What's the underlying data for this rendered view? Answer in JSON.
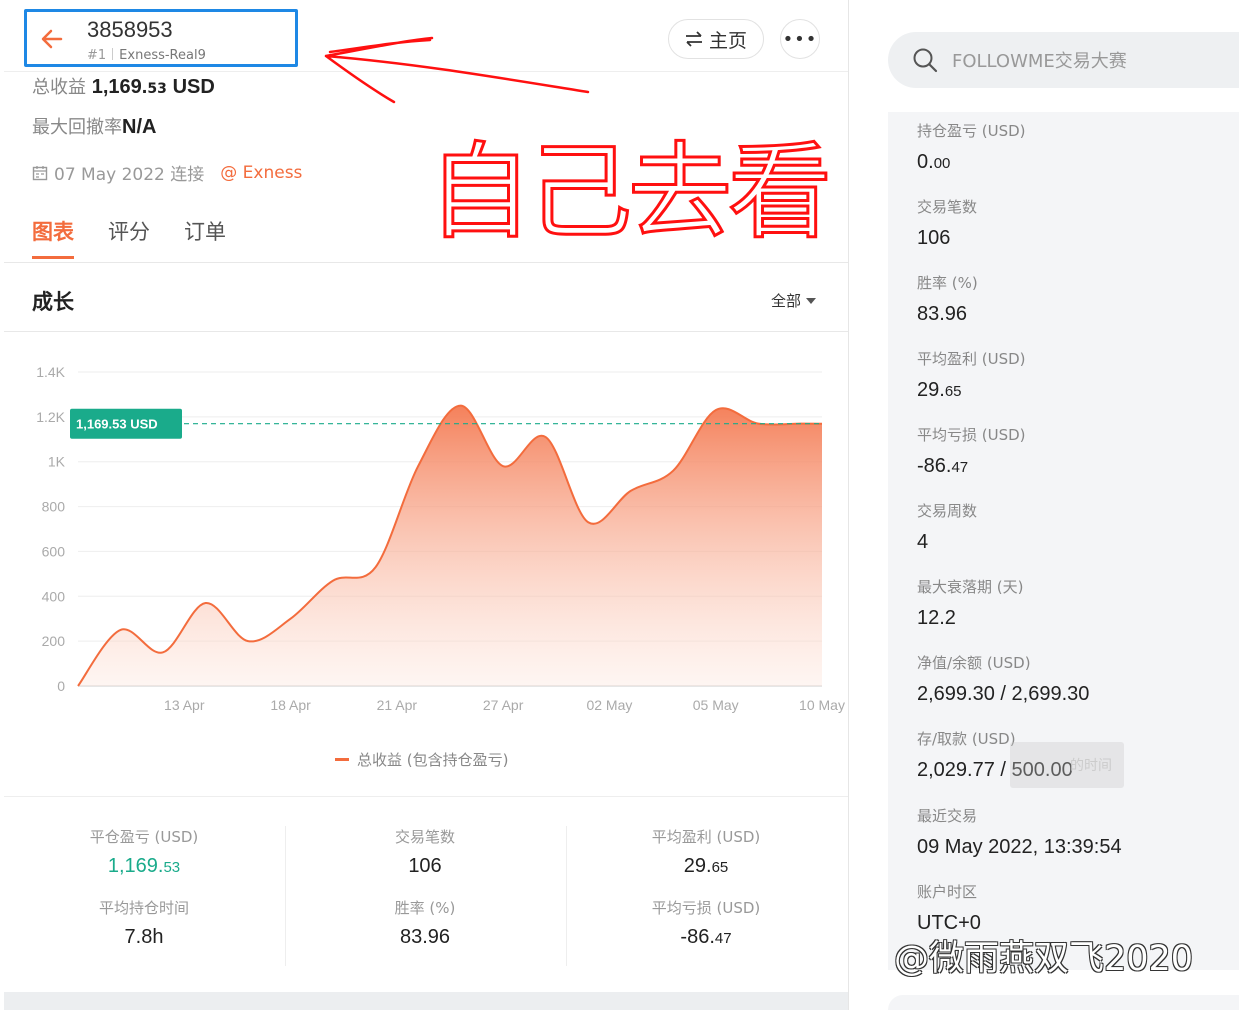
{
  "header": {
    "account_id": "3858953",
    "rank": "#1",
    "server": "Exness-Real9",
    "home_label": "主页",
    "more_label": "•••"
  },
  "summary": {
    "total_profit_label": "总收益",
    "total_profit_value": "1,169.",
    "total_profit_cents": "53",
    "total_profit_unit": "USD",
    "max_drawdown_label": "最大回撤率",
    "max_drawdown_value": "N/A",
    "connected_date": "07 May 2022 连接",
    "broker": "@ Exness"
  },
  "annotation": {
    "handwritten_text": "自己去看"
  },
  "tabs": [
    {
      "label": "图表",
      "active": true
    },
    {
      "label": "评分",
      "active": false
    },
    {
      "label": "订单",
      "active": false
    }
  ],
  "growth": {
    "title": "成长",
    "range_label": "全部"
  },
  "chart_data": {
    "type": "area",
    "title": "",
    "xlabel": "",
    "ylabel": "",
    "ylim": [
      0,
      1400
    ],
    "yticks": [
      "0",
      "200",
      "400",
      "600",
      "800",
      "1K",
      "1.2K",
      "1.4K"
    ],
    "x_ticks": [
      "13 Apr",
      "18 Apr",
      "21 Apr",
      "27 Apr",
      "02 May",
      "05 May",
      "10 May"
    ],
    "x": [
      0,
      0.4,
      0.8,
      1.2,
      1.6,
      2.0,
      2.4,
      2.8,
      3.2,
      3.6,
      4.0,
      4.4,
      4.8,
      5.2,
      5.6,
      6.0,
      6.4,
      6.8,
      7.0
    ],
    "values": [
      0,
      250,
      150,
      370,
      200,
      300,
      470,
      530,
      980,
      1250,
      980,
      1110,
      730,
      870,
      960,
      1230,
      1170,
      1170,
      1169.53
    ],
    "series": [
      {
        "name": "总收益 (包含持仓盈亏)",
        "values": [
          0,
          250,
          150,
          370,
          200,
          300,
          470,
          530,
          980,
          1250,
          980,
          1110,
          730,
          870,
          960,
          1230,
          1170,
          1170,
          1169.53
        ]
      }
    ],
    "current_value_label": "1,169.53 USD",
    "current_value": 1169.53,
    "legend": "bottom"
  },
  "stats": [
    {
      "label": "平仓盈亏 (USD)",
      "value": "1,169.",
      "cents": "53",
      "green": true
    },
    {
      "label": "交易笔数",
      "value": "106",
      "cents": ""
    },
    {
      "label": "平均盈利 (USD)",
      "value": "29.",
      "cents": "65"
    },
    {
      "label": "平均持仓时间",
      "value": "7.8h",
      "cents": ""
    },
    {
      "label": "胜率 (%)",
      "value": "83.96",
      "cents": ""
    },
    {
      "label": "平均亏损 (USD)",
      "value": "-86.",
      "cents": "47"
    }
  ],
  "sidebar": {
    "search_placeholder": "FOLLOWME交易大赛",
    "items": [
      {
        "label": "持仓盈亏 (USD)",
        "value": "0.",
        "cents": "00"
      },
      {
        "label": "交易笔数",
        "value": "106",
        "cents": ""
      },
      {
        "label": "胜率 (%)",
        "value": "83.96",
        "cents": ""
      },
      {
        "label": "平均盈利 (USD)",
        "value": "29.",
        "cents": "65"
      },
      {
        "label": "平均亏损 (USD)",
        "value": "-86.",
        "cents": "47"
      },
      {
        "label": "交易周数",
        "value": "4",
        "cents": ""
      },
      {
        "label": "最大衰落期 (天)",
        "value": "12.2",
        "cents": ""
      },
      {
        "label": "净值/余额 (USD)",
        "value": "2,699.30 / 2,699.30",
        "cents": ""
      },
      {
        "label": "存/取款 (USD)",
        "value": "2,029.77 / 500.00",
        "cents": ""
      },
      {
        "label": "最近交易",
        "value": "09 May 2022, 13:39:54",
        "cents": ""
      },
      {
        "label": "账户时区",
        "value": "UTC+0",
        "cents": ""
      }
    ],
    "ghost_tooltip": "的时间"
  },
  "watermark": "@微雨燕双飞2020",
  "colors": {
    "accent": "#f36c3d",
    "green": "#1aab8b",
    "highlight_box": "#1e88e5",
    "annotation": "#ff0000"
  }
}
